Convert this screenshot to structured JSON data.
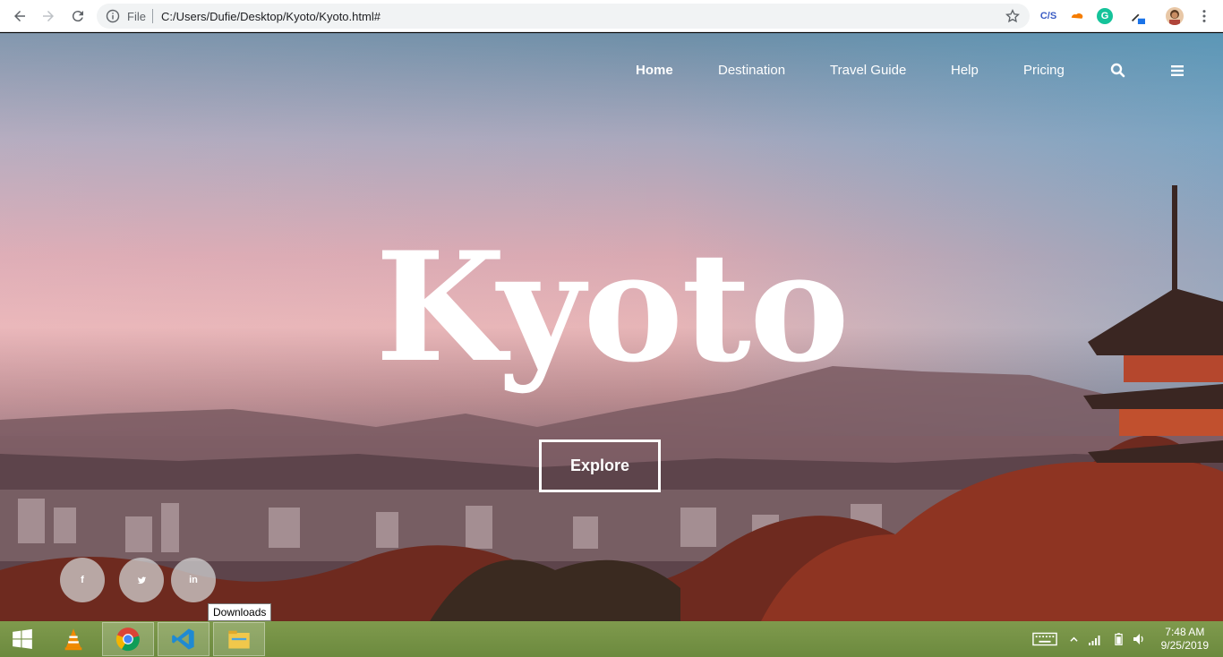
{
  "browser": {
    "omnibox_scheme": "File",
    "url": "C:/Users/Dufie/Desktop/Kyoto/Kyoto.html#",
    "extensions": [
      "C/S",
      "G"
    ]
  },
  "nav": {
    "items": [
      {
        "label": "Home",
        "active": true
      },
      {
        "label": "Destination"
      },
      {
        "label": "Travel Guide"
      },
      {
        "label": "Help"
      },
      {
        "label": "Pricing"
      }
    ],
    "icons": [
      "search-icon",
      "menu-icon"
    ]
  },
  "hero": {
    "title": "Kyoto",
    "button_label": "Explore"
  },
  "social": {
    "facebook": "f",
    "twitter": "✔",
    "linkedin": "in"
  },
  "tooltip": "Downloads",
  "taskbar": {
    "time": "7:48 AM",
    "date": "9/25/2019"
  },
  "colors": {
    "taskbar": "#6c8a3e",
    "text_white": "#ffffff"
  }
}
